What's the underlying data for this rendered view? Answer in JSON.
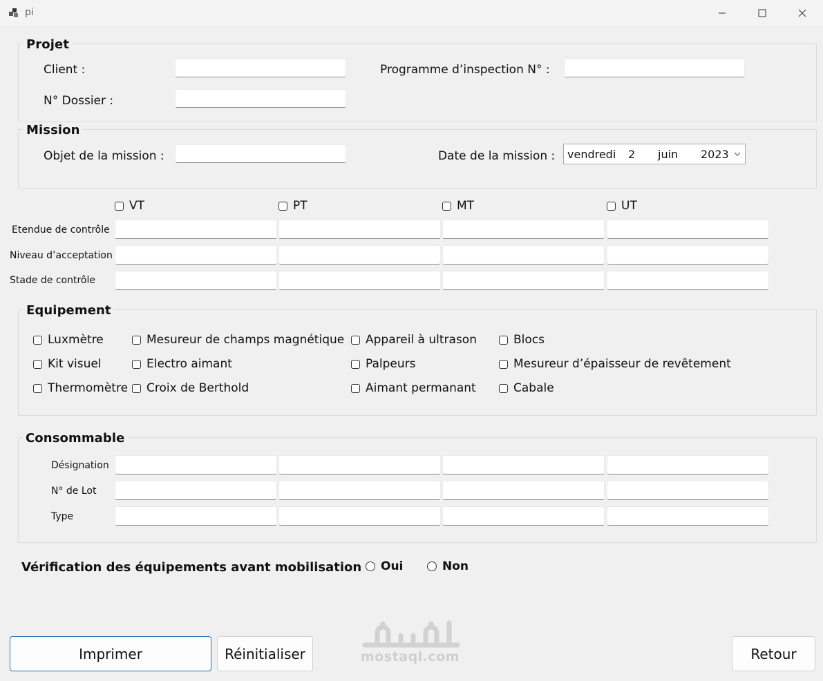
{
  "window": {
    "title": "pi",
    "icons": {
      "app": "app-icon",
      "minimize": "minimize-icon",
      "maximize": "maximize-icon",
      "close": "close-icon"
    }
  },
  "projet": {
    "title": "Projet",
    "client_label": "Client :",
    "client_value": "",
    "dossier_label": "N° Dossier :",
    "dossier_value": "",
    "programme_label": "Programme d’inspection N° :",
    "programme_value": ""
  },
  "mission": {
    "title": "Mission",
    "objet_label": "Objet de la mission :",
    "objet_value": "",
    "date_label": "Date de la mission :",
    "date": {
      "weekday": "vendredi",
      "day": "2",
      "month": "juin",
      "year": "2023"
    }
  },
  "controles": {
    "methods": [
      {
        "label": "VT",
        "checked": false
      },
      {
        "label": "PT",
        "checked": false
      },
      {
        "label": "MT",
        "checked": false
      },
      {
        "label": "UT",
        "checked": false
      }
    ],
    "rows": [
      "Etendue de contrôle",
      "Niveau d’acceptation",
      "Stade de contrôle"
    ]
  },
  "equipement": {
    "title": "Equipement",
    "items": [
      "Luxmètre",
      "Mesureur de champs magnétique",
      "Appareil à ultrason",
      "Blocs",
      "Kit visuel",
      "Electro aimant",
      "Palpeurs",
      "Mesureur d’épaisseur de revêtement",
      "Thermomètre",
      "Croix de Berthold",
      "Aimant permanant",
      "Cabale"
    ]
  },
  "consommable": {
    "title": "Consommable",
    "rows": [
      "Désignation",
      "N° de Lot",
      "Type"
    ]
  },
  "verification": {
    "label": "Vérification des équipements avant mobilisation",
    "oui": "Oui",
    "non": "Non",
    "selected": ""
  },
  "buttons": {
    "imprimer": "Imprimer",
    "reinitialiser": "Réinitialiser",
    "retour": "Retour"
  },
  "watermark": {
    "text": "mostaql.com",
    "logo": "mostaql-logo"
  }
}
